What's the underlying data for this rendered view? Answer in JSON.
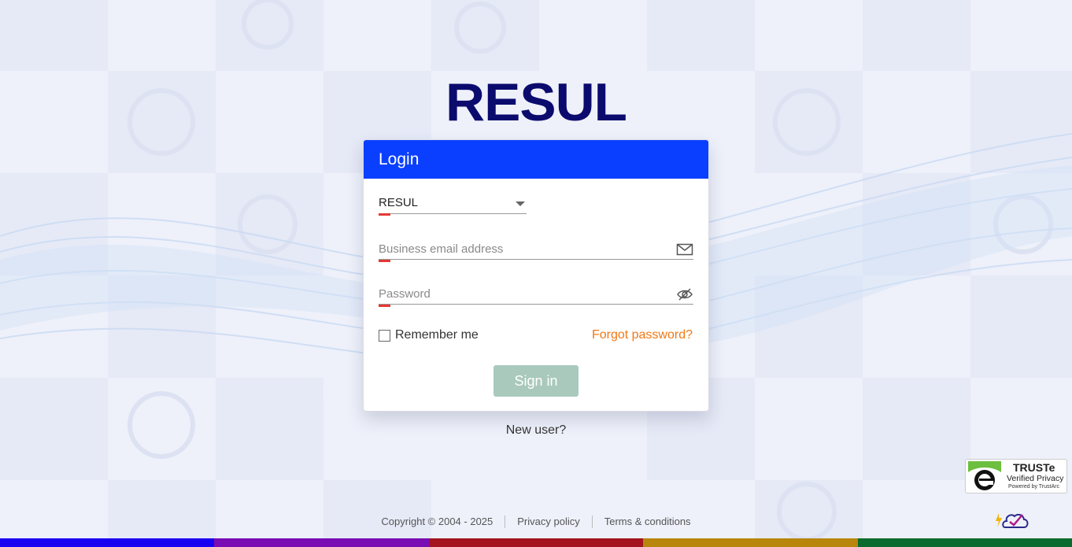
{
  "brand": {
    "logo_text": "RESUL"
  },
  "login": {
    "title": "Login",
    "account_select": {
      "value": "RESUL"
    },
    "email": {
      "placeholder": "Business email address",
      "value": ""
    },
    "password": {
      "placeholder": "Password",
      "value": ""
    },
    "remember_label": "Remember me",
    "forgot_label": "Forgot password?",
    "signin_label": "Sign in"
  },
  "new_user_label": "New user?",
  "footer": {
    "copyright": "Copyright © 2004 - 2025",
    "privacy": "Privacy policy",
    "terms": "Terms & conditions"
  },
  "truste": {
    "title": "TRUSTe",
    "subtitle": "Verified Privacy",
    "powered": "Powered by TrustArc"
  },
  "colors": {
    "header": "#0a3fff",
    "logo": "#0b0b6e",
    "link_accent": "#f07814",
    "signin_disabled": "#a9c9bd",
    "stripes": [
      "#1a00f0",
      "#7a0cb4",
      "#a3141e",
      "#b8860b",
      "#0b6b2e"
    ]
  }
}
